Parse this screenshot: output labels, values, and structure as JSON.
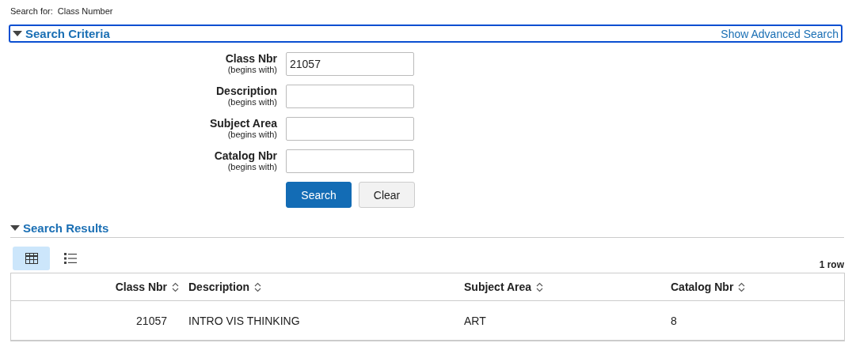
{
  "search_for": {
    "label": "Search for:",
    "value": "Class Number"
  },
  "search_criteria": {
    "title": "Search Criteria",
    "expanded": true,
    "link": "Show Advanced Search",
    "fields": [
      {
        "label": "Class Nbr",
        "hint": "(begins with)",
        "value": "21057"
      },
      {
        "label": "Description",
        "hint": "(begins with)"
      },
      {
        "label": "Subject Area",
        "hint": "(begins with)"
      },
      {
        "label": "Catalog Nbr",
        "hint": "(begins with)"
      }
    ],
    "buttons": [
      {
        "label": "Search",
        "kind": "primary"
      },
      {
        "label": "Clear",
        "kind": "secondary"
      }
    ]
  },
  "search_results": {
    "title": "Search Results",
    "expanded": true,
    "views": [
      {
        "kind": "grid",
        "selected": true
      },
      {
        "kind": "list",
        "selected": false
      }
    ],
    "row_count": "1 row",
    "table": {
      "columns": [
        {
          "label": "Class Nbr",
          "kind": "numeric"
        },
        {
          "label": "Description",
          "kind": "text"
        },
        {
          "label": "Subject Area",
          "kind": "text"
        },
        {
          "label": "Catalog Nbr",
          "kind": "text"
        }
      ],
      "rows": [
        [
          "21057",
          "INTRO VIS THINKING",
          "ART",
          "8"
        ]
      ]
    }
  }
}
